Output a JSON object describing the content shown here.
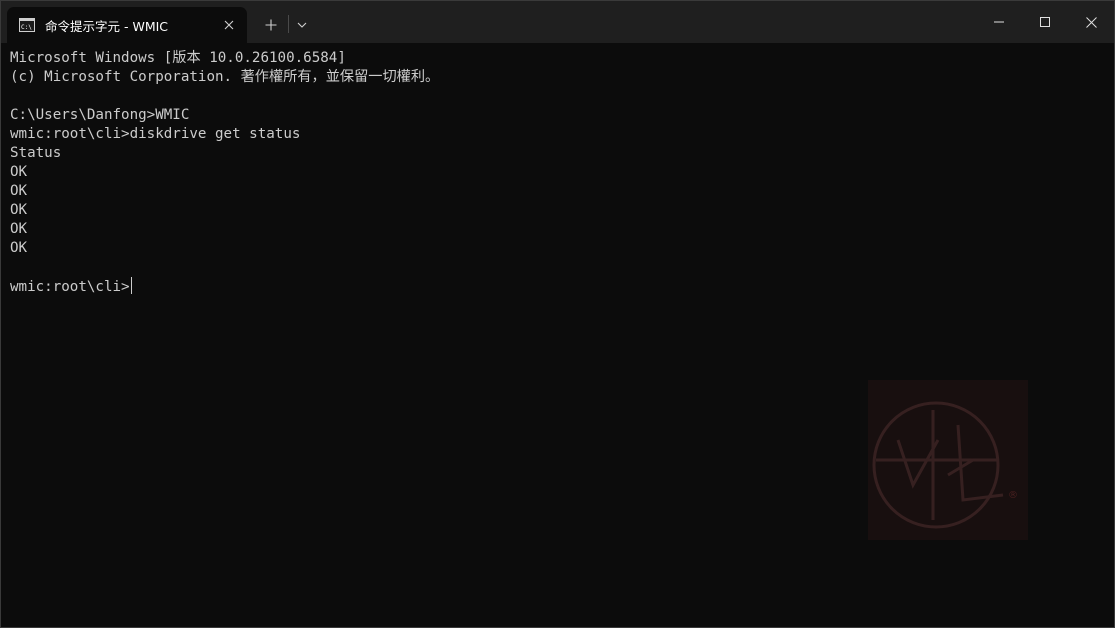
{
  "tab": {
    "title": "命令提示字元 - WMIC",
    "icon": "cmd-icon"
  },
  "controls": {
    "new_tab": "plus-icon",
    "dropdown": "chevron-down-icon",
    "minimize": "minimize-icon",
    "maximize": "maximize-icon",
    "close": "close-icon"
  },
  "terminal": {
    "lines": [
      "Microsoft Windows [版本 10.0.26100.6584]",
      "(c) Microsoft Corporation. 著作權所有，並保留一切權利。",
      "",
      "C:\\Users\\Danfong>WMIC",
      "wmic:root\\cli>diskdrive get status",
      "Status",
      "OK",
      "OK",
      "OK",
      "OK",
      "OK",
      "",
      "wmic:root\\cli>"
    ]
  },
  "colors": {
    "background": "#0c0c0c",
    "titlebar": "#1f1f1f",
    "text": "#cccccc"
  },
  "watermark": {
    "icon": "watermark-seal-icon"
  }
}
